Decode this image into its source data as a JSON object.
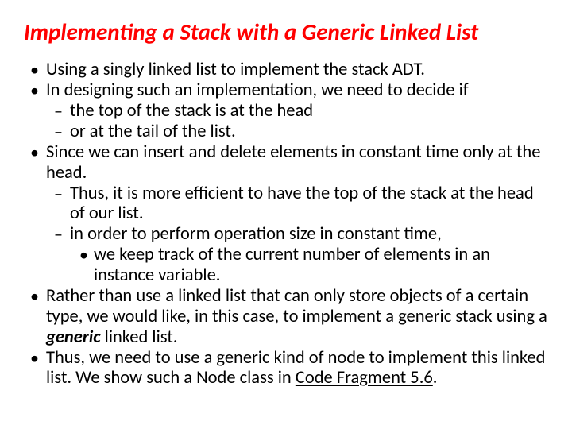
{
  "title_color": "#ff0000",
  "title": "Implementing a Stack with a Generic Linked List",
  "bullets": {
    "b1": "Using a singly linked list to implement the stack ADT.",
    "b2": "In designing such an implementation, we need to decide if",
    "b2a": "the top of the stack is at the head",
    "b2b": "or at the tail of the list.",
    "b3": "Since we can insert and delete elements in constant time only at the head.",
    "b3a": "Thus, it is more efficient to have the top of the stack at the head of our list.",
    "b3b": "in order to perform operation size in constant time,",
    "b3b1": "we keep track of the current number of elements in an instance variable.",
    "b4_pre": "Rather than use a linked list that can only store objects of a certain type, we would like, in this case, to implement a generic stack using a ",
    "b4_bold": "generic",
    "b4_post": " linked list.",
    "b5_pre": "Thus, we need to use a generic kind of node to implement this linked list. We show such a Node class in ",
    "b5_link": "Code Fragment 5.6",
    "b5_post": "."
  }
}
